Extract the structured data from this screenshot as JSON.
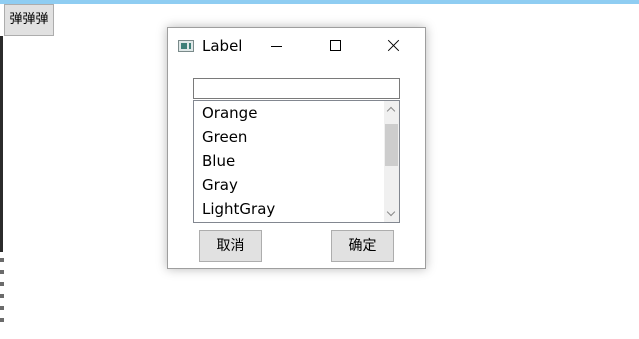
{
  "main_button": {
    "label": "弹弹弹"
  },
  "dialog": {
    "title": "Label",
    "text_input": {
      "value": "",
      "placeholder": ""
    },
    "list": {
      "items": [
        "Orange",
        "Green",
        "Blue",
        "Gray",
        "LightGray"
      ]
    },
    "buttons": {
      "cancel": "取消",
      "ok": "确定"
    }
  }
}
